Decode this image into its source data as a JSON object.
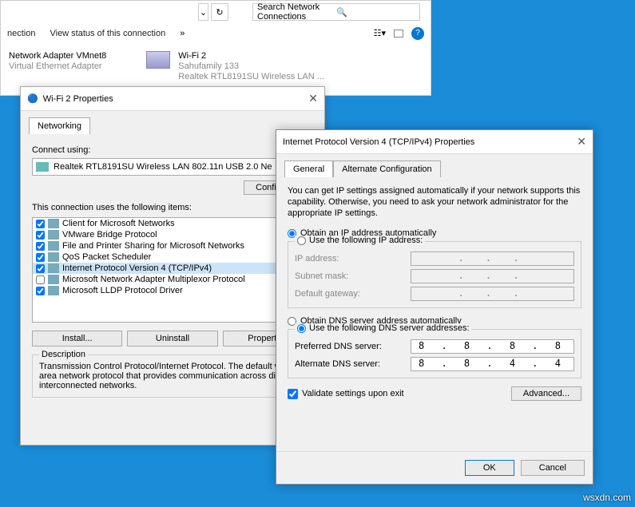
{
  "explorer": {
    "search_placeholder": "Search Network Connections",
    "toolbar_connection": "nection",
    "toolbar_status": "View status of this connection",
    "adapter1_name": "Network Adapter VMnet8",
    "adapter1_sub": "Virtual Ethernet Adapter",
    "adapter2_name": "Wi-Fi 2",
    "adapter2_sub1": "Sahufamily  133",
    "adapter2_sub2": "Realtek RTL8191SU Wireless LAN ..."
  },
  "dlg1": {
    "title": "Wi-Fi 2 Properties",
    "tab_networking": "Networking",
    "connect_using": "Connect using:",
    "adapter": "Realtek RTL8191SU Wireless LAN 802.11n USB 2.0 Ne",
    "configure": "Configure...",
    "items_label": "This connection uses the following items:",
    "items": [
      {
        "checked": true,
        "label": "Client for Microsoft Networks"
      },
      {
        "checked": true,
        "label": "VMware Bridge Protocol"
      },
      {
        "checked": true,
        "label": "File and Printer Sharing for Microsoft Networks"
      },
      {
        "checked": true,
        "label": "QoS Packet Scheduler"
      },
      {
        "checked": true,
        "label": "Internet Protocol Version 4 (TCP/IPv4)",
        "selected": true
      },
      {
        "checked": false,
        "label": "Microsoft Network Adapter Multiplexor Protocol"
      },
      {
        "checked": true,
        "label": "Microsoft LLDP Protocol Driver"
      }
    ],
    "btn_install": "Install...",
    "btn_uninstall": "Uninstall",
    "btn_properties": "Properties",
    "desc_title": "Description",
    "desc_text": "Transmission Control Protocol/Internet Protocol. The default wide area network protocol that provides communication across diverse interconnected networks."
  },
  "dlg2": {
    "title": "Internet Protocol Version 4 (TCP/IPv4) Properties",
    "tab_general": "General",
    "tab_alt": "Alternate Configuration",
    "info": "You can get IP settings assigned automatically if your network supports this capability. Otherwise, you need to ask your network administrator for the appropriate IP settings.",
    "ip_auto": "Obtain an IP address automatically",
    "ip_manual": "Use the following IP address:",
    "ip_addr_label": "IP address:",
    "subnet_label": "Subnet mask:",
    "gateway_label": "Default gateway:",
    "dns_auto": "Obtain DNS server address automatically",
    "dns_manual": "Use the following DNS server addresses:",
    "pref_dns_label": "Preferred DNS server:",
    "alt_dns_label": "Alternate DNS server:",
    "pref_dns_value": "8 . 8 . 8 . 8",
    "alt_dns_value": "8 . 8 . 4 . 4",
    "validate": "Validate settings upon exit",
    "advanced": "Advanced...",
    "ok": "OK",
    "cancel": "Cancel"
  },
  "watermark": "wsxdn.com"
}
